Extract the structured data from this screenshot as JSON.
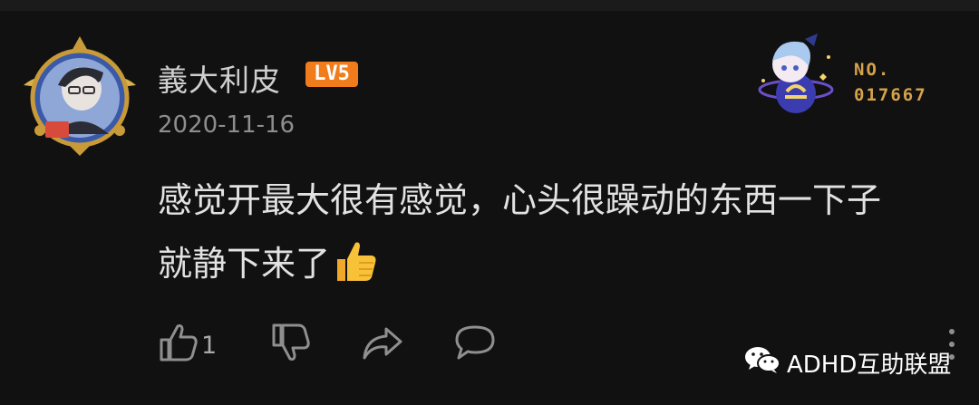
{
  "user": {
    "name": "義大利皮",
    "level_badge": "LV5",
    "date": "2020-11-16"
  },
  "badge": {
    "no_label": "NO.",
    "number": "017667"
  },
  "comment": {
    "line1": "感觉开最大很有感觉，心头很躁动的东西一下子",
    "line2": "就静下来了",
    "emoji": "thumbs-up"
  },
  "actions": {
    "like_count": "1",
    "icons": [
      "thumbs-up-icon",
      "thumbs-down-icon",
      "share-icon",
      "comment-icon",
      "more-icon"
    ]
  },
  "watermark": {
    "text": "ADHD互助联盟",
    "icon": "wechat-icon"
  },
  "colors": {
    "background": "#111111",
    "level_badge": "#f07c1b",
    "badge_number": "#d6a24a"
  }
}
